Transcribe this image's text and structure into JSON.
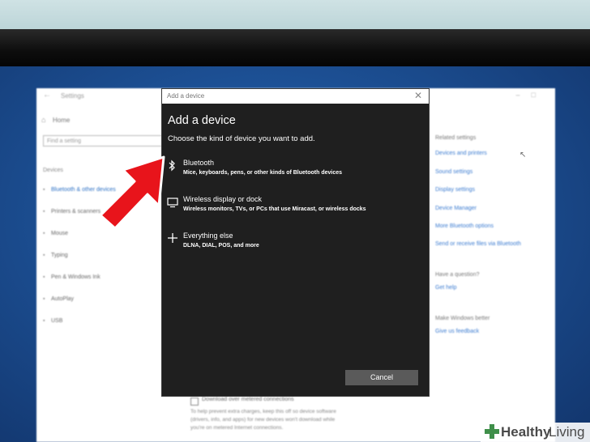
{
  "settings_bg": {
    "title": "Settings",
    "home": "Home",
    "search_placeholder": "Find a setting",
    "section": "Devices",
    "nav_items": [
      "Bluetooth & other devices",
      "Printers & scanners",
      "Mouse",
      "Typing",
      "Pen & Windows Ink",
      "AutoPlay",
      "USB"
    ],
    "related_title": "Related settings",
    "related_links": [
      "Devices and printers",
      "Sound settings",
      "Display settings",
      "Device Manager",
      "More Bluetooth options",
      "Send or receive files via Bluetooth"
    ],
    "question_title": "Have a question?",
    "question_link": "Get help",
    "better_title": "Make Windows better",
    "better_link": "Give us feedback",
    "metered_label": "Download over metered connections",
    "metered_desc": [
      "To help prevent extra charges, keep this off so device software",
      "(drivers, info, and apps) for new devices won't download while",
      "you're on metered Internet connections."
    ]
  },
  "dialog": {
    "titlebar": "Add a device",
    "close": "✕",
    "heading": "Add a device",
    "subheading": "Choose the kind of device you want to add.",
    "options": [
      {
        "label": "Bluetooth",
        "desc": "Mice, keyboards, pens, or other kinds of Bluetooth devices",
        "icon": "bluetooth-icon"
      },
      {
        "label": "Wireless display or dock",
        "desc": "Wireless monitors, TVs, or PCs that use Miracast, or wireless docks",
        "icon": "monitor-icon"
      },
      {
        "label": "Everything else",
        "desc": "DLNA, DIAL, POS, and more",
        "icon": "plus-icon"
      }
    ],
    "cancel": "Cancel"
  },
  "watermark": {
    "bold": "Healthy",
    "light": "Living"
  },
  "colors": {
    "dialog_bg": "#1f1f1f",
    "arrow": "#e8141b",
    "link": "#3b7bd0",
    "button": "#5a5a5a"
  }
}
